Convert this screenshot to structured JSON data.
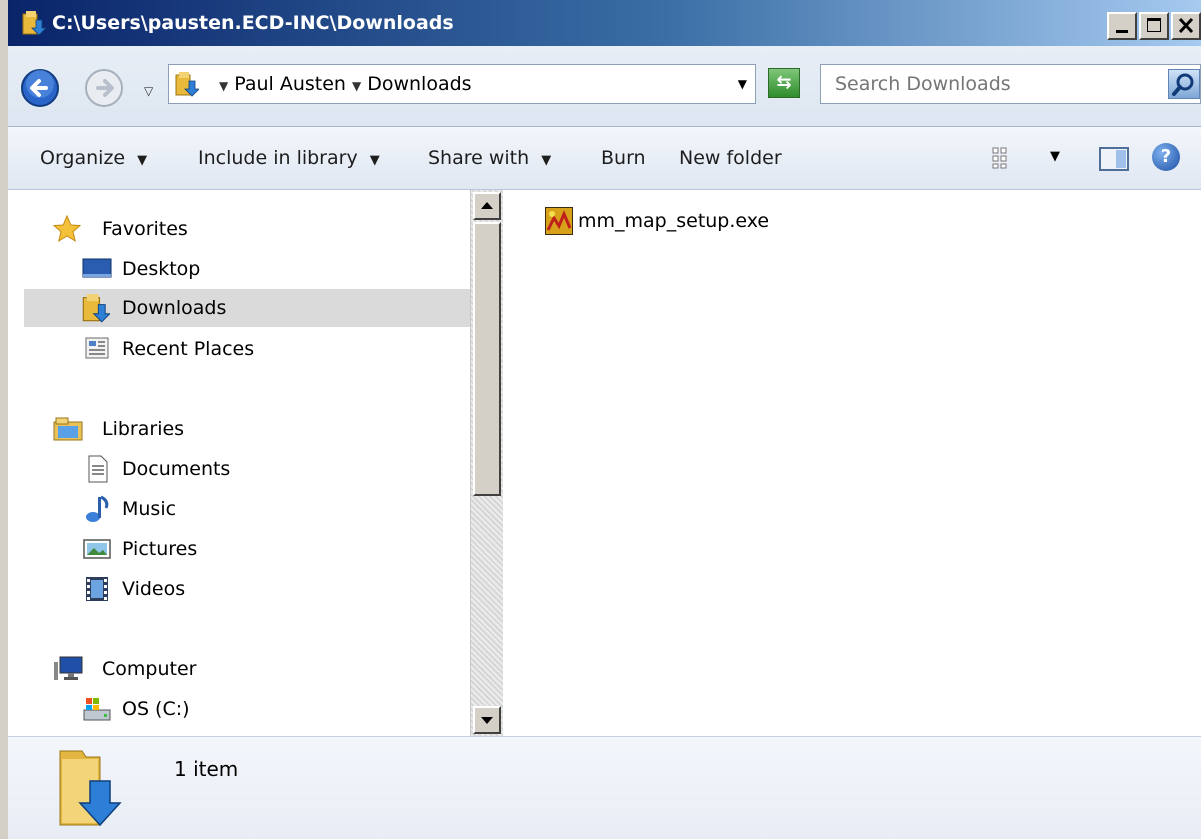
{
  "window": {
    "title": "C:\\Users\\pausten.ECD-INC\\Downloads"
  },
  "navbar": {
    "breadcrumb": [
      "Paul Austen",
      "Downloads"
    ],
    "search_placeholder": "Search Downloads"
  },
  "toolbar": {
    "organize": "Organize",
    "include_in_library": "Include in library",
    "share_with": "Share with",
    "burn": "Burn",
    "new_folder": "New folder",
    "help": "?"
  },
  "navpane": {
    "favorites": "Favorites",
    "desktop": "Desktop",
    "downloads": "Downloads",
    "recent_places": "Recent Places",
    "libraries": "Libraries",
    "documents": "Documents",
    "music": "Music",
    "pictures": "Pictures",
    "videos": "Videos",
    "computer": "Computer",
    "os_c": "OS (C:)"
  },
  "content": {
    "files": [
      {
        "name": "mm_map_setup.exe",
        "icon": "installer-exe-icon"
      }
    ]
  },
  "details": {
    "item_count": "1 item"
  },
  "colors": {
    "title_bar_start": "#0a246a",
    "selection": "#dadada"
  }
}
